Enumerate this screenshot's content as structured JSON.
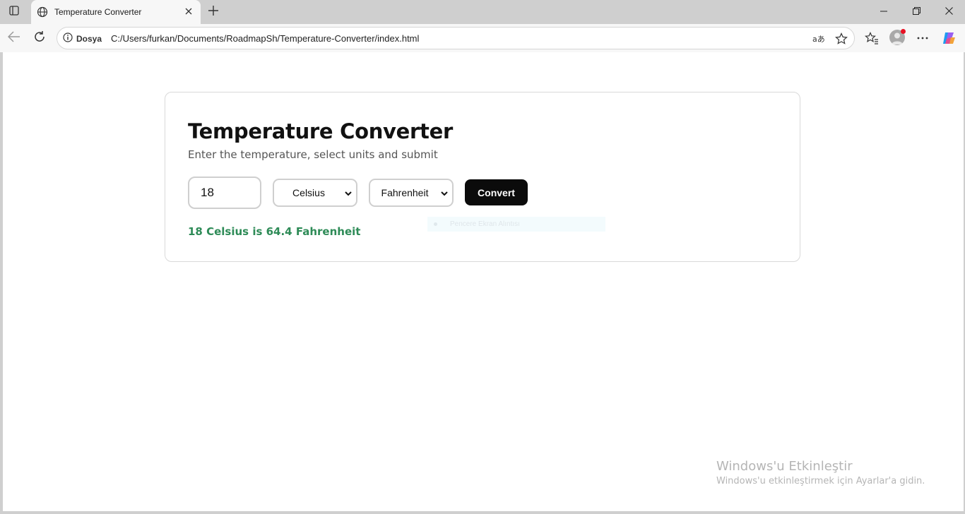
{
  "browser": {
    "tab": {
      "title": "Temperature Converter"
    },
    "address": {
      "site_label": "Dosya",
      "url": "C:/Users/furkan/Documents/RoadmapSh/Temperature-Converter/index.html"
    },
    "icons": [
      "sidebar-icon",
      "globe-icon",
      "close-icon",
      "plus-icon",
      "minimize-icon",
      "restore-icon",
      "back-icon",
      "reload-icon",
      "info-icon",
      "read-aloud-icon",
      "star-icon",
      "favorites-icon",
      "avatar",
      "more-icon",
      "copilot-icon"
    ]
  },
  "converter": {
    "title": "Temperature Converter",
    "subtitle": "Enter the temperature, select units and submit",
    "input_value": "18",
    "from_unit": "Celsius",
    "to_unit": "Fahrenheit",
    "button_label": "Convert",
    "result": "18 Celsius is 64.4 Fahrenheit",
    "result_color": "#2e8b57"
  },
  "overlay": {
    "snip_label": "Pencere Ekran Alıntısı"
  },
  "watermark": {
    "title": "Windows'u Etkinleştir",
    "subtitle": "Windows'u etkinleştirmek için Ayarlar'a gidin."
  }
}
